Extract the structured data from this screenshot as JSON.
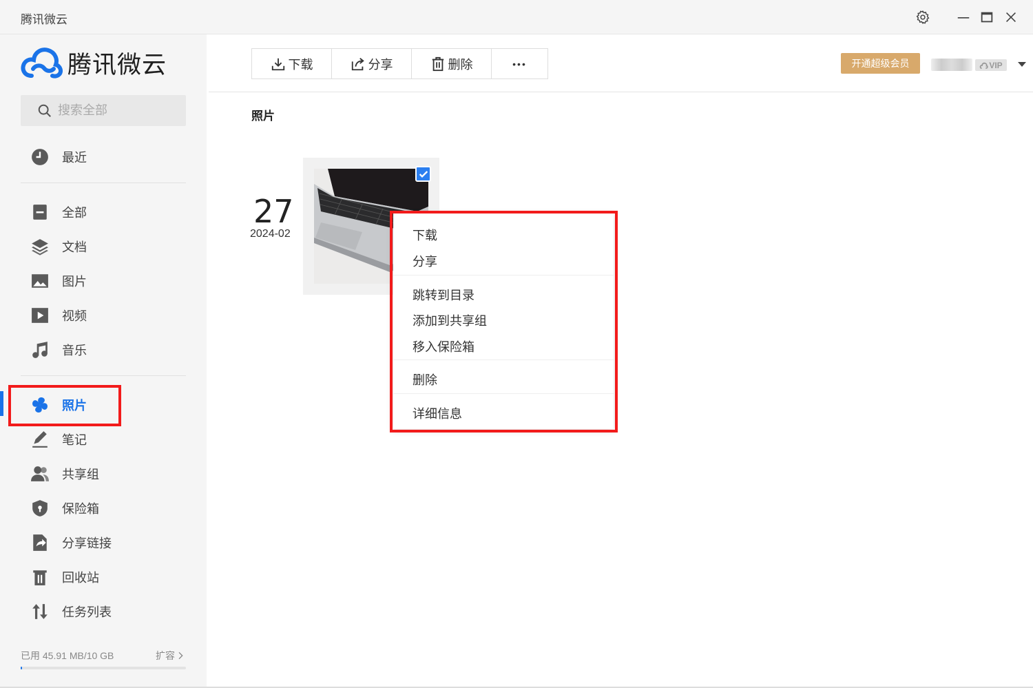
{
  "window": {
    "title": "腾讯微云"
  },
  "sidebar": {
    "logo_text": "腾讯微云",
    "search_placeholder": "搜索全部",
    "items": [
      {
        "label": "最近",
        "icon": "clock-icon"
      },
      {
        "label": "全部",
        "icon": "file-icon"
      },
      {
        "label": "文档",
        "icon": "layers-icon"
      },
      {
        "label": "图片",
        "icon": "image-icon"
      },
      {
        "label": "视频",
        "icon": "play-icon"
      },
      {
        "label": "音乐",
        "icon": "music-icon"
      },
      {
        "label": "照片",
        "icon": "photo-pinwheel-icon",
        "active": true
      },
      {
        "label": "笔记",
        "icon": "pencil-icon"
      },
      {
        "label": "共享组",
        "icon": "users-icon"
      },
      {
        "label": "保险箱",
        "icon": "shield-icon"
      },
      {
        "label": "分享链接",
        "icon": "share-link-icon"
      },
      {
        "label": "回收站",
        "icon": "trash-icon"
      },
      {
        "label": "任务列表",
        "icon": "transfer-icon"
      }
    ],
    "storage_used": "已用 45.91 MB/10 GB",
    "storage_fraction": 0.0045,
    "expand_label": "扩容"
  },
  "toolbar": {
    "download": "下载",
    "share": "分享",
    "delete": "删除",
    "more": "•••"
  },
  "header": {
    "vip_button": "开通超级会员",
    "vip_badge": "VIP"
  },
  "main": {
    "section_title": "照片",
    "date_day": "27",
    "date_ym": "2024-02"
  },
  "context_menu": {
    "items": [
      "下载",
      "分享",
      "跳转到目录",
      "添加到共享组",
      "移入保险箱",
      "删除",
      "详细信息"
    ]
  },
  "colors": {
    "accent": "#1a73e8",
    "highlight": "#f21b1b",
    "vip": "#d8a96b"
  }
}
